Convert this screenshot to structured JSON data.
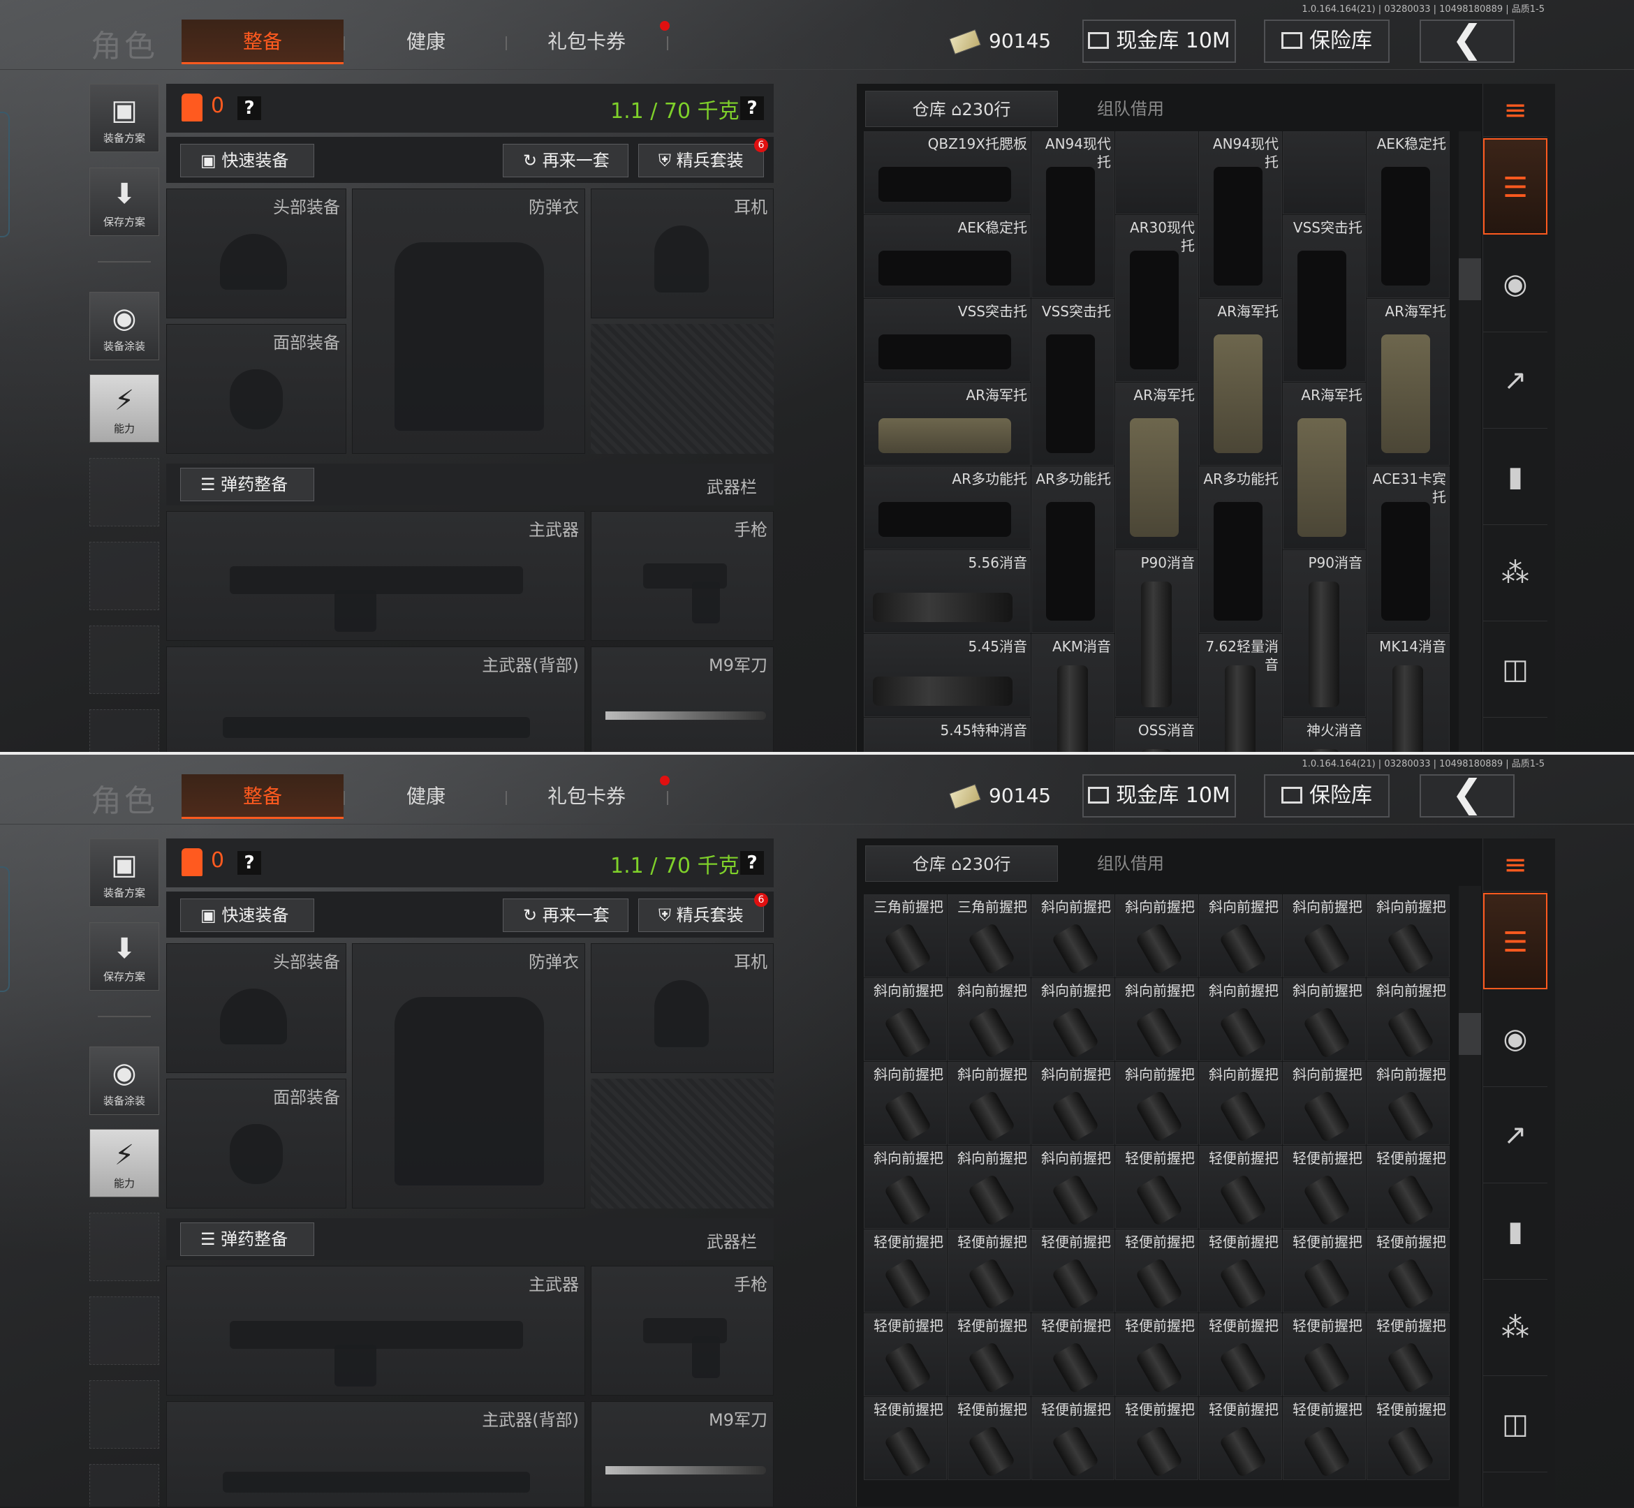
{
  "panels": [
    {
      "version": "1.0.164.164(21) | 03280033 | 10498180889 | 品质1-5",
      "title": "角色",
      "tabs": [
        "整备",
        "健康",
        "礼包卡券"
      ],
      "money": "90145",
      "cash_vault": "现金库 10M",
      "safe_vault": "保险库",
      "side_buttons": [
        "装备方案",
        "保存方案",
        "装备涂装",
        "能力"
      ],
      "armor_count": "0",
      "weight": "1.1 / 70 千克",
      "help": "?",
      "quick_equip": "快速装备",
      "again": "再来一套",
      "elite_set": "精兵套装",
      "elite_badge": "6",
      "slots": {
        "head": "头部装备",
        "vest": "防弹衣",
        "ear": "耳机",
        "face": "面部装备",
        "ammo": "弹药整备",
        "weapons": "武器栏",
        "primary": "主武器",
        "pistol": "手枪",
        "primary_back": "主武器(背部)",
        "knife": "M9军刀"
      },
      "inv_tabs": [
        "仓库",
        "230行",
        "组队借用"
      ],
      "items": [
        {
          "name": "QBZ19X托腮板"
        },
        {
          "name": "AN94现代托"
        },
        {
          "name": ""
        },
        {
          "name": "AN94现代托"
        },
        {
          "name": ""
        },
        {
          "name": "AEK稳定托"
        },
        {
          "name": "AEK稳定托"
        },
        {
          "name": "AR30现代托"
        },
        {
          "name": "VSS突击托"
        },
        {
          "name": "VSS突击托"
        },
        {
          "name": "VSS突击托"
        },
        {
          "name": "AR海军托"
        },
        {
          "name": "AR海军托"
        },
        {
          "name": "AR海军托"
        },
        {
          "name": "AR海军托"
        },
        {
          "name": "AR海军托"
        },
        {
          "name": "AR多功能托"
        },
        {
          "name": "AR多功能托"
        },
        {
          "name": "AR多功能托"
        },
        {
          "name": "ACE31卡宾托"
        },
        {
          "name": "5.56消音"
        },
        {
          "name": "P90消音"
        },
        {
          "name": "P90消音"
        },
        {
          "name": "5.45消音"
        },
        {
          "name": "AKM消音"
        },
        {
          "name": "7.62轻量消音"
        },
        {
          "name": "MK14消音"
        },
        {
          "name": "5.45特种消音"
        },
        {
          "name": "OSS消音"
        },
        {
          "name": "神火消音"
        }
      ]
    },
    {
      "version": "1.0.164.164(21) | 03280033 | 10498180889 | 品质1-5",
      "title": "角色",
      "tabs": [
        "整备",
        "健康",
        "礼包卡券"
      ],
      "money": "90145",
      "cash_vault": "现金库 10M",
      "safe_vault": "保险库",
      "side_buttons": [
        "装备方案",
        "保存方案",
        "装备涂装",
        "能力"
      ],
      "armor_count": "0",
      "weight": "1.1 / 70 千克",
      "help": "?",
      "quick_equip": "快速装备",
      "again": "再来一套",
      "elite_set": "精兵套装",
      "elite_badge": "6",
      "slots": {
        "head": "头部装备",
        "vest": "防弹衣",
        "ear": "耳机",
        "face": "面部装备",
        "ammo": "弹药整备",
        "weapons": "武器栏",
        "primary": "主武器",
        "pistol": "手枪",
        "primary_back": "主武器(背部)",
        "knife": "M9军刀"
      },
      "inv_tabs": [
        "仓库",
        "230行",
        "组队借用"
      ],
      "grip_rows": [
        [
          "三角前握把",
          "三角前握把",
          "斜向前握把",
          "斜向前握把",
          "斜向前握把",
          "斜向前握把",
          "斜向前握把"
        ],
        [
          "斜向前握把",
          "斜向前握把",
          "斜向前握把",
          "斜向前握把",
          "斜向前握把",
          "斜向前握把",
          "斜向前握把"
        ],
        [
          "斜向前握把",
          "斜向前握把",
          "斜向前握把",
          "斜向前握把",
          "斜向前握把",
          "斜向前握把",
          "斜向前握把"
        ],
        [
          "斜向前握把",
          "斜向前握把",
          "斜向前握把",
          "轻便前握把",
          "轻便前握把",
          "轻便前握把",
          "轻便前握把"
        ],
        [
          "轻便前握把",
          "轻便前握把",
          "轻便前握把",
          "轻便前握把",
          "轻便前握把",
          "轻便前握把",
          "轻便前握把"
        ],
        [
          "轻便前握把",
          "轻便前握把",
          "轻便前握把",
          "轻便前握把",
          "轻便前握把",
          "轻便前握把",
          "轻便前握把"
        ],
        [
          "轻便前握把",
          "轻便前握把",
          "轻便前握把",
          "轻便前握把",
          "轻便前握把",
          "轻便前握把",
          "轻便前握把"
        ]
      ]
    }
  ],
  "colors": {
    "accent": "#ff5a1f",
    "weight": "#7fd12a",
    "badge": "#e01010"
  }
}
